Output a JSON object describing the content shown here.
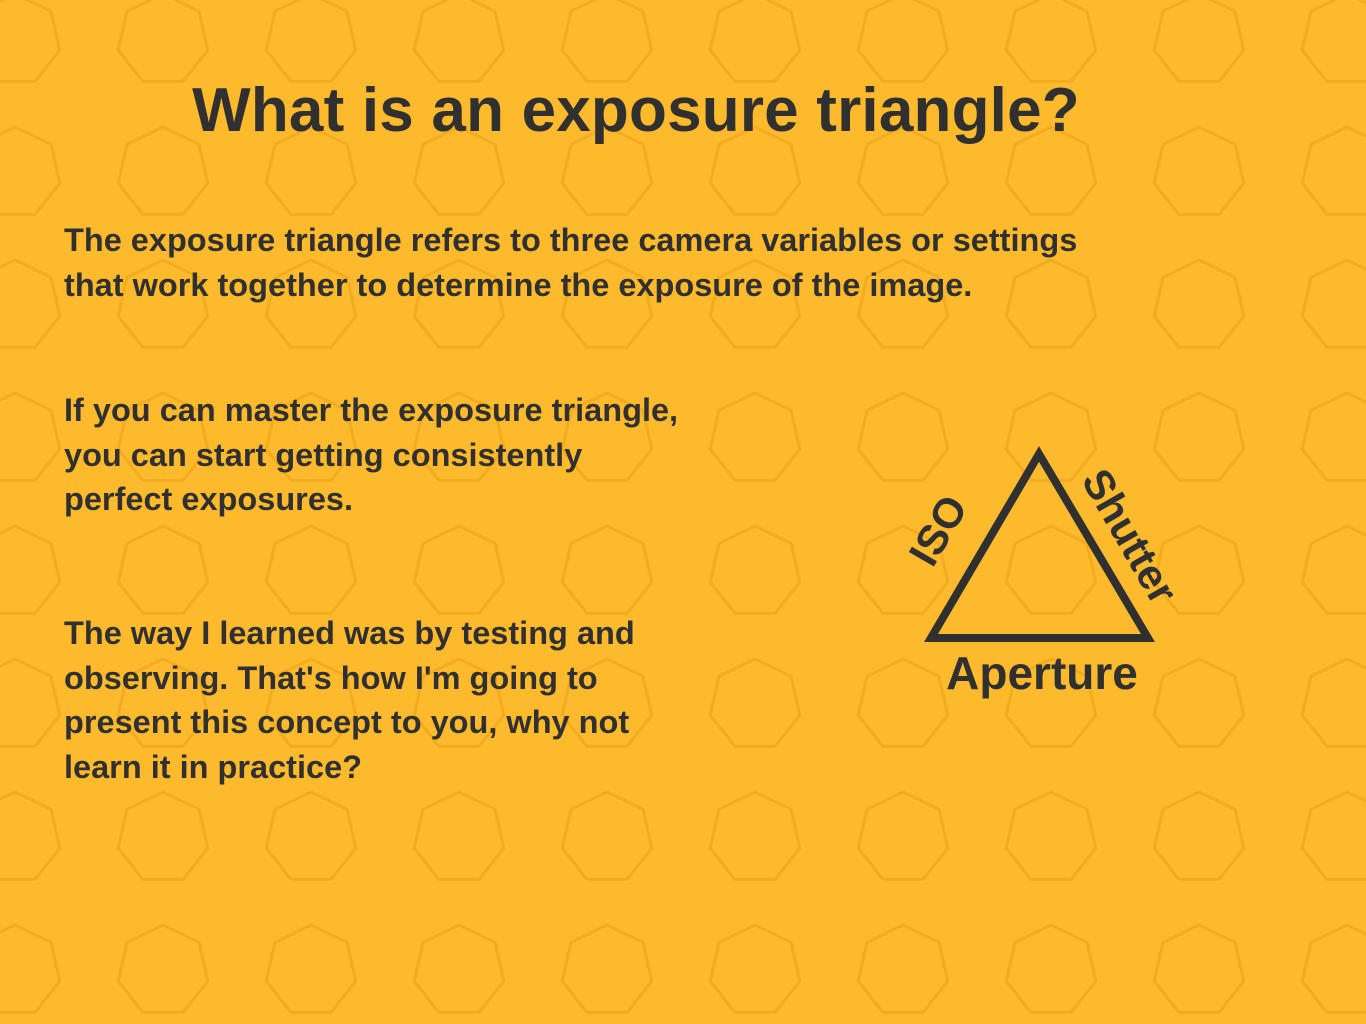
{
  "title": "What is an exposure triangle?",
  "paragraphs": [
    {
      "lines": [
        "The exposure triangle refers to three camera variables or settings",
        "that work together to determine the exposure of the image."
      ]
    },
    {
      "lines": [
        "If you can master the exposure triangle,",
        "you can start getting consistently",
        "perfect exposures."
      ]
    },
    {
      "lines": [
        "The way I learned was by testing and",
        "observing. That's how I'm going to",
        "present this concept to you, why not",
        "learn it in practice?"
      ]
    }
  ],
  "diagram": {
    "labels": {
      "left": "ISO",
      "right": "Shutter",
      "bottom": "Aperture"
    }
  },
  "colors": {
    "background": "#FDBA2D",
    "pattern": "#F3AC1E",
    "text": "#303030"
  }
}
